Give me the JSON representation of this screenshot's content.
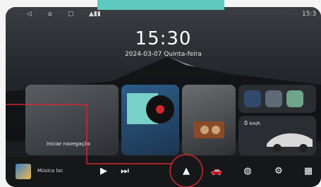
{
  "status_bar": {
    "left_icons": [
      "back-icon",
      "home-icon",
      "recents-icon",
      "signal-icons"
    ],
    "right_time": "15:3"
  },
  "home": {
    "time": "15:30",
    "date": "2024-03-07 Quinta-feira"
  },
  "cards": {
    "navigation_label": "Iniciar navegação",
    "speed_value": "0",
    "speed_unit": "km/h"
  },
  "dock": {
    "music_label": "Música loc",
    "items": [
      "play-icon",
      "next-icon",
      "navigation-icon",
      "car-icon",
      "music-disc-icon",
      "settings-icon",
      "apps-grid-icon"
    ]
  },
  "colors": {
    "accent_teal": "#5ec9be",
    "highlight_red": "#d1282e"
  }
}
